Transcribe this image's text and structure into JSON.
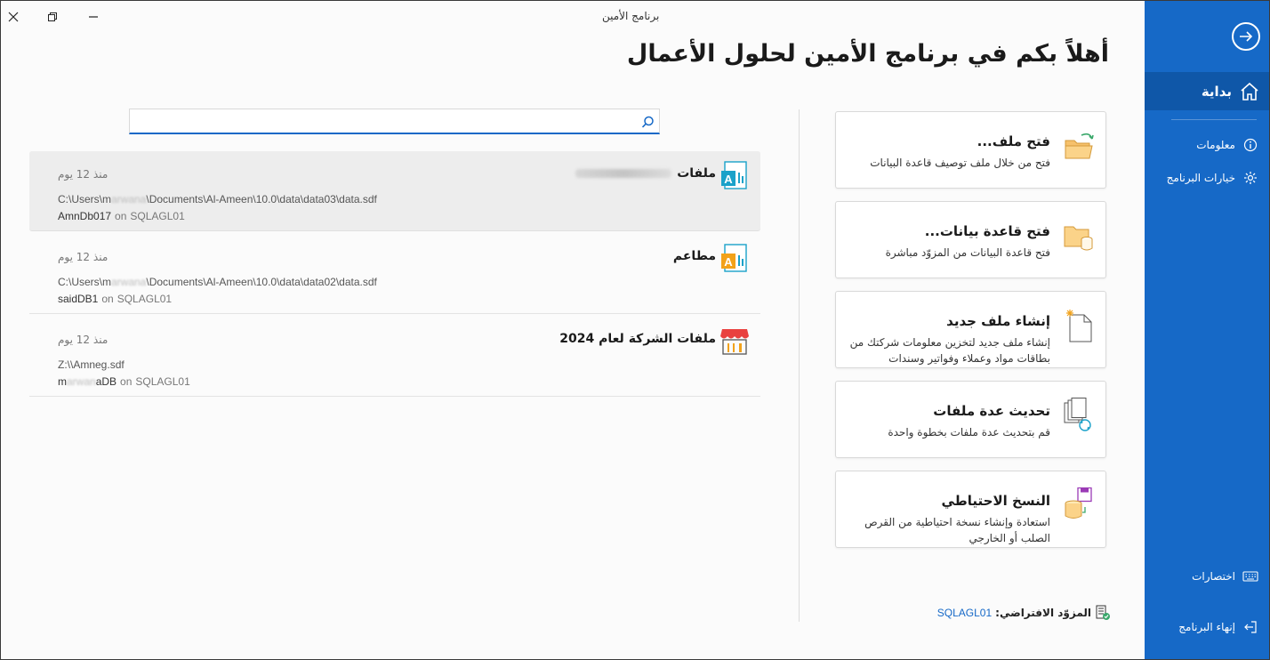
{
  "window": {
    "title": "برنامج الأمين"
  },
  "sidebar": {
    "start_label": "بداية",
    "items": [
      {
        "label": "معلومات"
      },
      {
        "label": "خيارات البرنامج"
      }
    ],
    "shortcuts_label": "اختصارات",
    "exit_label": "إنهاء البرنامج"
  },
  "main": {
    "heading": "أهلاً بكم في برنامج الأمين لحلول الأعمال",
    "search": {
      "value": "",
      "placeholder": ""
    }
  },
  "recent": [
    {
      "title": "ملفات",
      "time": "منذ 12 يوم",
      "path_prefix": "C:\\Users\\m",
      "path_blur": "arwana",
      "path_suffix": "\\Documents\\Al-Ameen\\10.0\\data\\data03\\data.sdf",
      "db": "AmnDb017",
      "on": "on",
      "server": "SQLAGL01"
    },
    {
      "title": "مطاعم",
      "time": "منذ 12 يوم",
      "path_prefix": "C:\\Users\\m",
      "path_blur": "arwana",
      "path_suffix": "\\Documents\\Al-Ameen\\10.0\\data\\data02\\data.sdf",
      "db": "saidDB1",
      "on": "on",
      "server": "SQLAGL01"
    },
    {
      "title": "ملفات الشركة لعام 2024",
      "time": "منذ 12 يوم",
      "path": "Z:\\\\Amneg.sdf",
      "db_prefix": "m",
      "db_blur": "arwan",
      "db_suffix": "aDB",
      "on": "on",
      "server": "SQLAGL01"
    }
  ],
  "actions": [
    {
      "title": "فتح ملف...",
      "desc": "فتح من خلال ملف توصيف قاعدة البيانات",
      "icon": "folder-open-icon"
    },
    {
      "title": "فتح قاعدة بيانات...",
      "desc": "فتح قاعدة البيانات من المزوّد مباشرة",
      "icon": "folder-database-icon"
    },
    {
      "title": "إنشاء ملف جديد",
      "desc": "إنشاء ملف جديد لتخزين معلومات شركتك من بطاقات مواد وعملاء وفواتير وسندات",
      "icon": "new-file-icon"
    },
    {
      "title": "تحديث عدة ملفات",
      "desc": "قم بتحديث عدة ملفات بخطوة واحدة",
      "icon": "update-files-icon"
    },
    {
      "title": "النسخ الاحتياطي",
      "desc": "استعادة وإنشاء نسخة احتياطية من القرص الصلب أو الخارجي",
      "icon": "backup-icon"
    }
  ],
  "provider": {
    "label": "المزوّد الافتراضي:",
    "value": "SQLAGL01"
  },
  "colors": {
    "accent": "#1669c7",
    "sidebar_active": "#0f57a8"
  }
}
